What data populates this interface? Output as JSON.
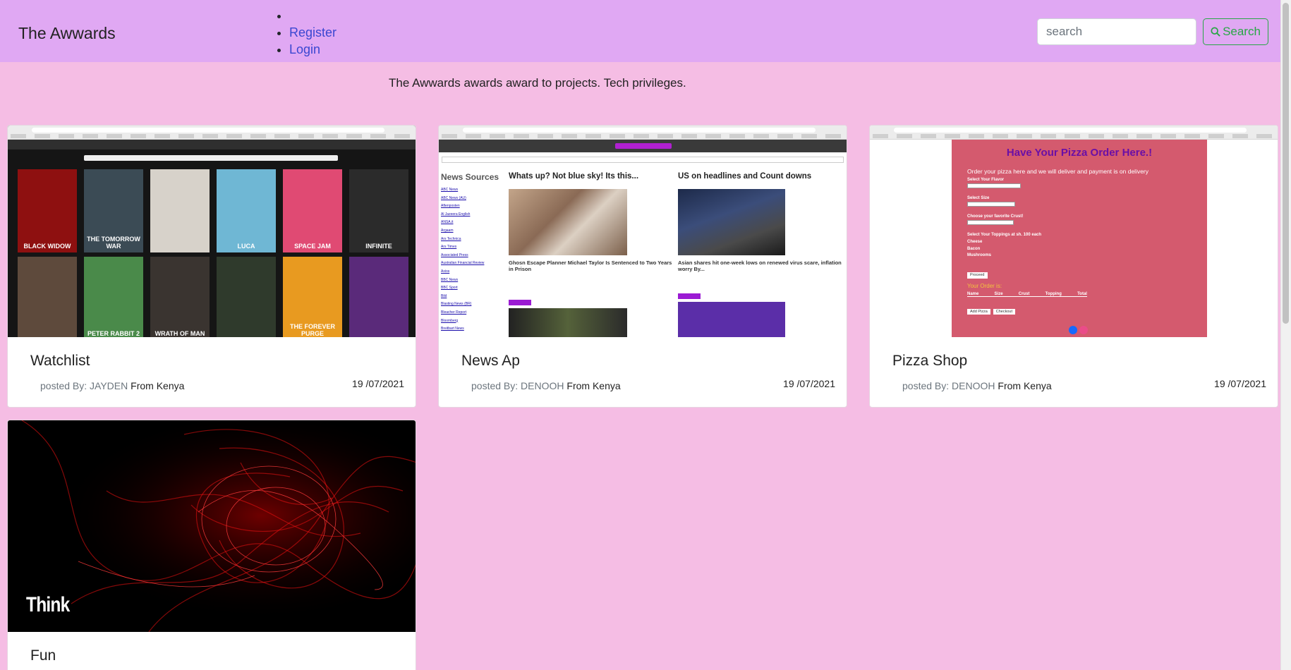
{
  "brand": "The Awwards",
  "nav": {
    "items": [
      "",
      "Register",
      "Login"
    ]
  },
  "search": {
    "placeholder": "search",
    "button_label": "Search"
  },
  "tagline": "The Awwards awards award to projects. Tech privileges.",
  "colors": {
    "navbar": "#e0a8f3",
    "page": "#f5bde4",
    "link": "#3a47d1",
    "search_button": "#28a745",
    "pizza": "#d45a6e"
  },
  "cards": [
    {
      "title": "Watchlist",
      "posted_by": "posted By: JAYDEN",
      "from": "From Kenya",
      "date": "19 /07/2021",
      "preview": {
        "posters": [
          "BLACK WIDOW",
          "THE TOMORROW WAR",
          "",
          "LUCA",
          "SPACE JAM",
          "INFINITE",
          "",
          "PETER RABBIT 2",
          "WRATH OF MAN",
          "",
          "THE FOREVER PURGE",
          ""
        ]
      }
    },
    {
      "title": "News Ap",
      "posted_by": "posted By: DENOOH",
      "from": "From Kenya",
      "date": "19 /07/2021",
      "preview": {
        "sidebar_title": "News Sources",
        "col1_heading": "Whats up? Not blue sky! Its this...",
        "col2_heading": "US on headlines and Count downs",
        "col1_caption": "Ghosn Escape Planner Michael Taylor Is Sentenced to Two Years in Prison",
        "col2_caption": "Asian shares hit one-week lows on renewed virus scare, inflation worry By...",
        "sources": [
          "ABC News",
          "ABC News (AU)",
          "Aftenposten",
          "Al Jazeera English",
          "ANSA.it",
          "Argaam",
          "Ars Technica",
          "Ars Times",
          "Associated Press",
          "Australian Financial Review",
          "Axios",
          "BBC News",
          "BBC Sport",
          "Bild",
          "Blasting News (BR)",
          "Bleacher Report",
          "Bloomberg",
          "Breitbart News"
        ]
      }
    },
    {
      "title": "Pizza Shop",
      "posted_by": "posted By: DENOOH",
      "from": "From Kenya",
      "date": "19 /07/2021",
      "preview": {
        "heading": "Have Your Pizza Order Here.!",
        "intro": "Order your pizza here and we will deliver and payment is on delivery",
        "flavor_label": "Select Your Flavor",
        "size_label": "Select Size",
        "crust_label": "Choose your favorite Crust!",
        "toppings_label": "Select Your Toppings at sh. 100 each",
        "toppings": [
          "Cheese",
          "Bacon",
          "Mushrooms"
        ],
        "proceed": "Proceed",
        "order_label": "Your Order is:",
        "columns": [
          "Name",
          "Size",
          "Crust",
          "Topping",
          "Total"
        ],
        "buttons": [
          "Add Pizza",
          "Checkout"
        ]
      }
    },
    {
      "title": "Fun",
      "posted_by": "",
      "from": "",
      "date": "",
      "preview": {
        "logo": "Think"
      }
    }
  ]
}
